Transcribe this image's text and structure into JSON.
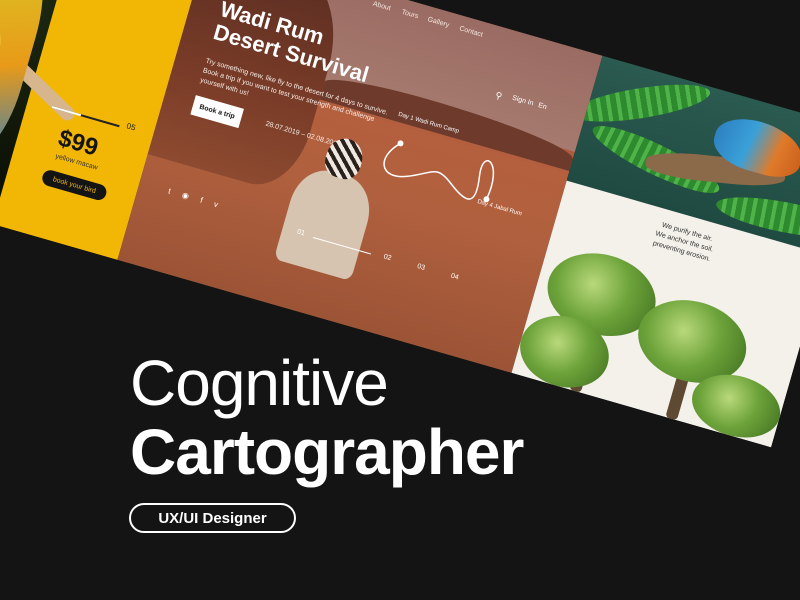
{
  "colors": {
    "background": "#141414",
    "parrot_card": "#f2b705",
    "desert_sand": "#b45f3e",
    "text": "#ffffff"
  },
  "headline": {
    "line1": "Cognitive",
    "line2": "Cartographer",
    "role_badge": "UX/UI Designer"
  },
  "parrot_card": {
    "slide_number": "05",
    "price": "$99",
    "price_caption": "yellow macaw",
    "cta": "book your bird"
  },
  "desert_card": {
    "nav": [
      "About",
      "Tours",
      "Gallery",
      "Contact"
    ],
    "search_icon": "search-icon",
    "sign_in": "Sign In",
    "language": "En",
    "title": "Wadi Rum\nDesert Survival",
    "description": "Try something new, like fly to the desert for 4 days to survive. Book a trip if you want to test your strength and challenge yourself with us!",
    "cta": "Book a trip",
    "dates": "28.07.2019 – 02.08.2019",
    "route_labels": [
      "Day 1 Wadi Rum Camp",
      "Day 4 Jabal Rum"
    ],
    "socials": [
      "twitter-icon",
      "instagram-icon",
      "facebook-icon",
      "vimeo-icon"
    ],
    "pager": [
      "01",
      "02",
      "03",
      "04"
    ]
  },
  "tree_card": {
    "text": "We purify the air.\nWe anchor the soil.\npreventing erosion."
  }
}
